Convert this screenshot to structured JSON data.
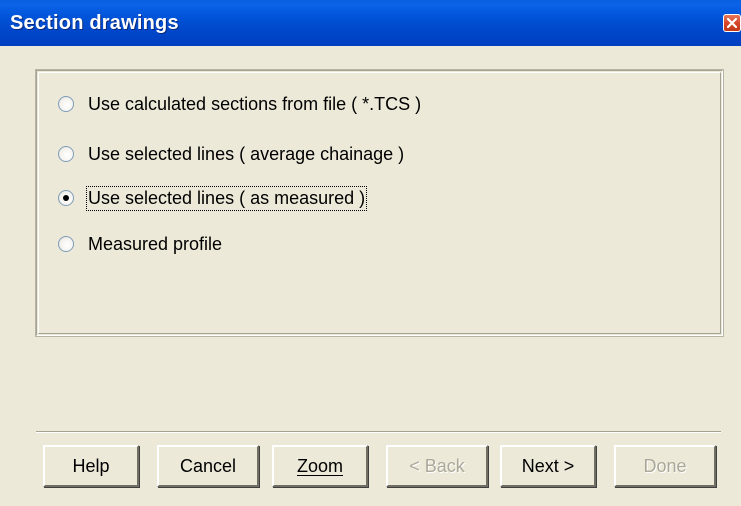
{
  "window": {
    "title": "Section drawings",
    "close_icon": "close-icon"
  },
  "options": [
    {
      "label": "Use calculated sections from file ( *.TCS )",
      "selected": false
    },
    {
      "label": "Use selected lines ( average chainage )",
      "selected": false
    },
    {
      "label": "Use selected lines ( as measured )",
      "selected": true
    },
    {
      "label": "Measured profile",
      "selected": false
    }
  ],
  "buttons": {
    "help": "Help",
    "cancel": "Cancel",
    "zoom": "Zoom",
    "back": "< Back",
    "next": "Next >",
    "done": "Done"
  }
}
